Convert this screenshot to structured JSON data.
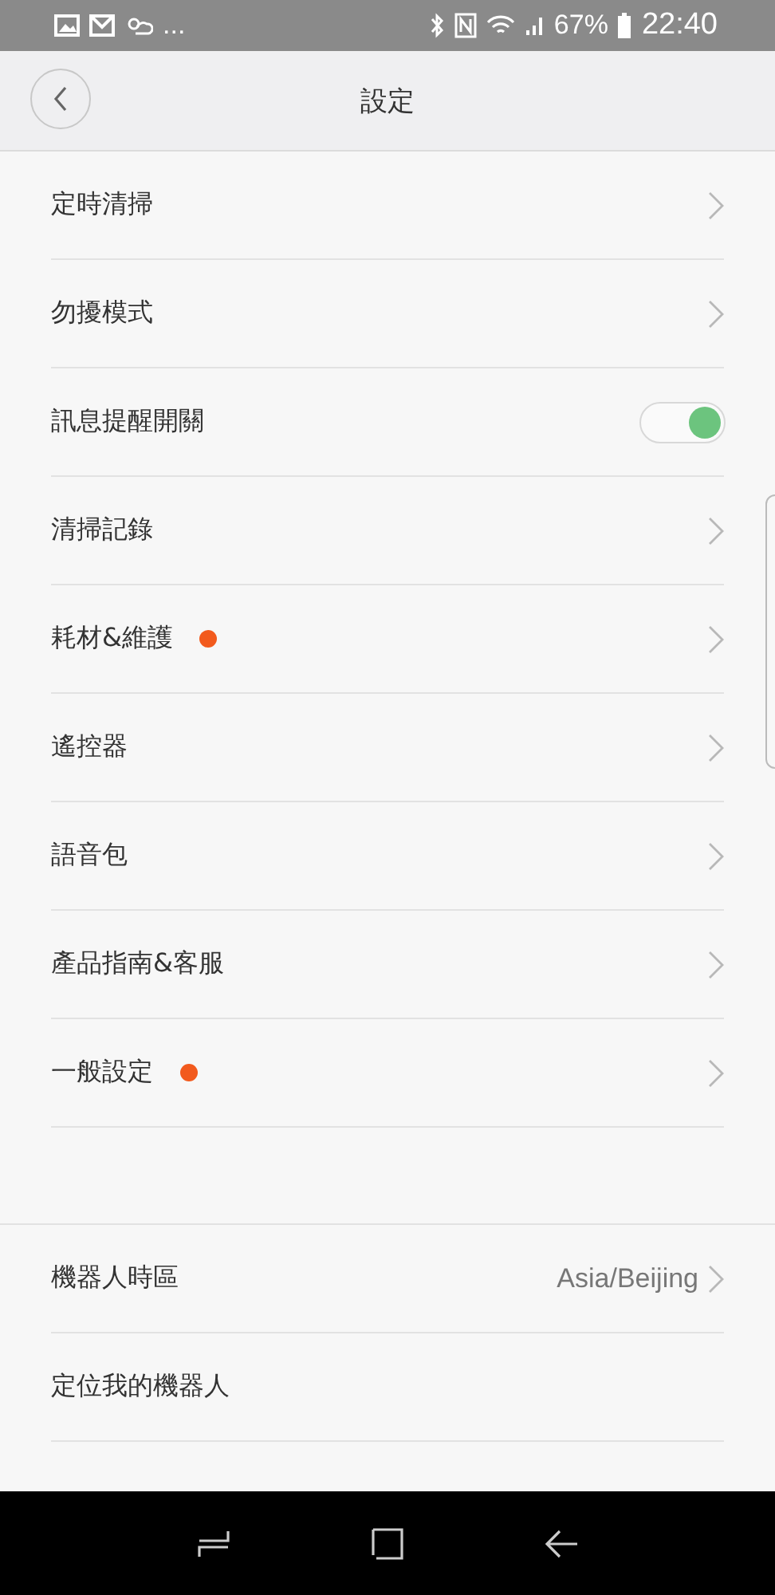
{
  "status_bar": {
    "more": "...",
    "battery": "67%",
    "time": "22:40"
  },
  "header": {
    "title": "設定"
  },
  "sections": [
    [
      {
        "kind": "link",
        "label": "定時清掃",
        "badge": false
      },
      {
        "kind": "link",
        "label": "勿擾模式",
        "badge": false
      },
      {
        "kind": "toggle",
        "label": "訊息提醒開關",
        "on": true
      },
      {
        "kind": "link",
        "label": "清掃記錄",
        "badge": false
      },
      {
        "kind": "link",
        "label": "耗材&維護",
        "badge": true
      },
      {
        "kind": "link",
        "label": "遙控器",
        "badge": false
      },
      {
        "kind": "link",
        "label": "語音包",
        "badge": false
      },
      {
        "kind": "link",
        "label": "產品指南&客服",
        "badge": false
      },
      {
        "kind": "link",
        "label": "一般設定",
        "badge": true
      }
    ],
    [
      {
        "kind": "link",
        "label": "機器人時區",
        "value": "Asia/Beijing",
        "badge": false
      },
      {
        "kind": "plain",
        "label": "定位我的機器人"
      }
    ]
  ]
}
